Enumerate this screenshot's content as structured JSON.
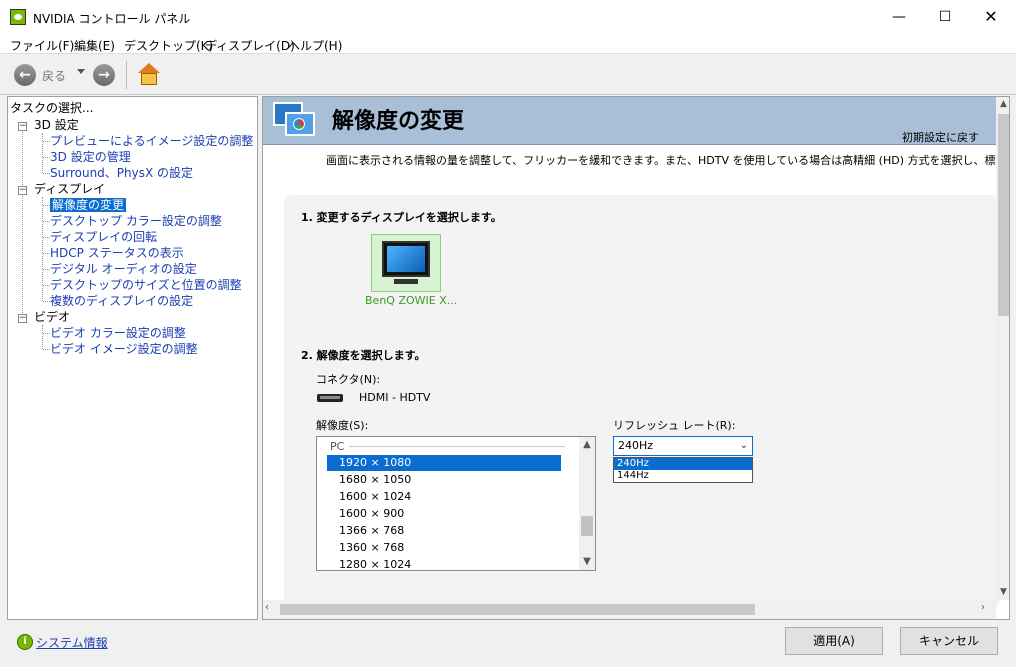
{
  "window": {
    "title": "NVIDIA コントロール パネル",
    "controls": {
      "minimize": "—",
      "maximize": "☐",
      "close": "✕"
    }
  },
  "menu": [
    "ファイル(F)",
    "編集(E)",
    "デスクトップ(K)",
    "ディスプレイ(D)",
    "ヘルプ(H)"
  ],
  "toolbar": {
    "back_label": "戻る"
  },
  "left_panel": {
    "title": "タスクの選択...",
    "tree": [
      {
        "label": "3D 設定",
        "children": [
          "プレビューによるイメージ設定の調整",
          "3D 設定の管理",
          "Surround、PhysX の設定"
        ]
      },
      {
        "label": "ディスプレイ",
        "children": [
          "解像度の変更",
          "デスクトップ カラー設定の調整",
          "ディスプレイの回転",
          "HDCP ステータスの表示",
          "デジタル オーディオの設定",
          "デスクトップのサイズと位置の調整",
          "複数のディスプレイの設定"
        ]
      },
      {
        "label": "ビデオ",
        "children": [
          "ビデオ カラー設定の調整",
          "ビデオ イメージ設定の調整"
        ]
      }
    ],
    "selected": "解像度の変更"
  },
  "page": {
    "title": "解像度の変更",
    "restore_defaults": "初期設定に戻す",
    "description": "画面に表示される情報の量を調整して、フリッカーを緩和できます。また、HDTV を使用している場合は高精細 (HD) 方式を選択し、標準画質",
    "step1": "1. 変更するディスプレイを選択します。",
    "display_name": "BenQ ZOWIE X...",
    "step2": "2. 解像度を選択します。",
    "connector_label": "コネクタ(N):",
    "connector_value": "HDMI - HDTV",
    "resolution_label": "解像度(S):",
    "refresh_label": "リフレッシュ レート(R):",
    "resolution_group": "PC",
    "resolutions": [
      "1920 × 1080",
      "1680 × 1050",
      "1600 × 1024",
      "1600 × 900",
      "1366 × 768",
      "1360 × 768",
      "1280 × 1024"
    ],
    "selected_resolution": "1920 × 1080",
    "refresh_selected": "240Hz",
    "refresh_options": [
      "240Hz",
      "144Hz"
    ]
  },
  "footer": {
    "system_info": "システム情報",
    "apply": "適用(A)",
    "cancel": "キャンセル"
  }
}
